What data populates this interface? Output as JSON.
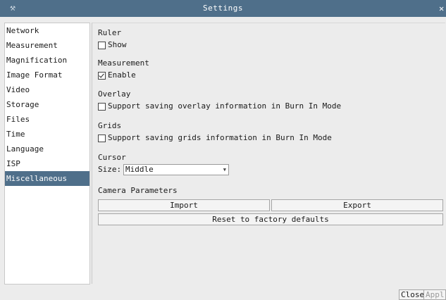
{
  "window": {
    "title": "Settings",
    "app_icon": "tools-icon",
    "close_glyph": "✕"
  },
  "colors": {
    "titlebar": "#4f6f8a",
    "selected": "#4f6f8a",
    "background": "#ececec"
  },
  "sidebar": {
    "selected": "Miscellaneous",
    "items": [
      {
        "label": "Network"
      },
      {
        "label": "Measurement"
      },
      {
        "label": "Magnification"
      },
      {
        "label": "Image Format"
      },
      {
        "label": "Video"
      },
      {
        "label": "Storage"
      },
      {
        "label": "Files"
      },
      {
        "label": "Time"
      },
      {
        "label": "Language"
      },
      {
        "label": "ISP"
      },
      {
        "label": "Miscellaneous"
      }
    ]
  },
  "main": {
    "ruler": {
      "label": "Ruler",
      "show_label": "Show",
      "show_checked": false
    },
    "measurement": {
      "label": "Measurement",
      "enable_label": "Enable",
      "enable_checked": true
    },
    "overlay": {
      "label": "Overlay",
      "option_label": "Support saving overlay information in Burn In Mode",
      "checked": false
    },
    "grids": {
      "label": "Grids",
      "option_label": "Support saving grids information in Burn In Mode",
      "checked": false
    },
    "cursor": {
      "label": "Cursor",
      "size_label": "Size:",
      "size_value": "Middle"
    },
    "camera": {
      "label": "Camera Parameters",
      "import_label": "Import",
      "export_label": "Export",
      "reset_label": "Reset to factory defaults"
    }
  },
  "footer": {
    "close_label": "Close",
    "apply_label": "Appl"
  }
}
